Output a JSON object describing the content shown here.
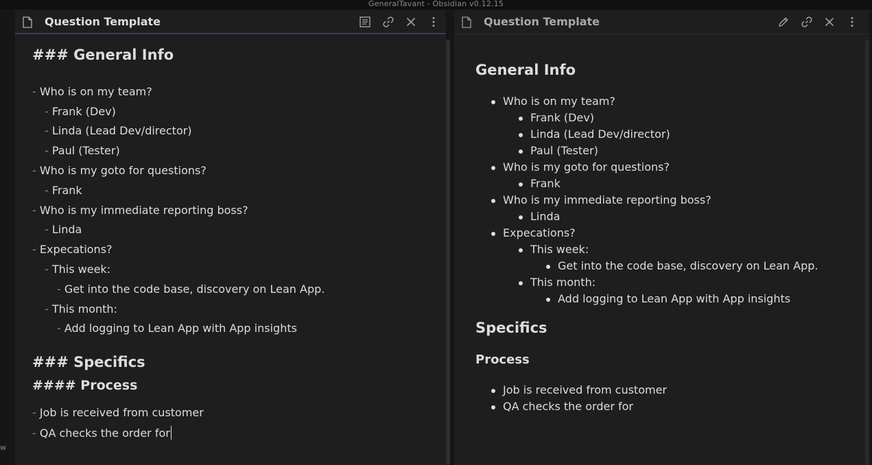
{
  "window": {
    "title": "GeneralTavant - Obsidian v0.12.15"
  },
  "left_strip": {
    "fragment": "w"
  },
  "left_pane": {
    "title": "Question Template",
    "icons": [
      "preview-icon",
      "link-icon",
      "close-icon",
      "more-options-icon"
    ],
    "lines": [
      {
        "text": "### General Info",
        "kind": "h3"
      },
      {
        "text": "- Who is on my team?",
        "kind": "li",
        "indent": 0
      },
      {
        "text": "- Frank (Dev)",
        "kind": "li",
        "indent": 1
      },
      {
        "text": "- Linda (Lead Dev/director)",
        "kind": "li",
        "indent": 1
      },
      {
        "text": "- Paul (Tester)",
        "kind": "li",
        "indent": 1
      },
      {
        "text": "- Who is my goto for questions?",
        "kind": "li",
        "indent": 0
      },
      {
        "text": "- Frank",
        "kind": "li",
        "indent": 1
      },
      {
        "text": "- Who is my immediate reporting boss?",
        "kind": "li",
        "indent": 0
      },
      {
        "text": "- Linda",
        "kind": "li",
        "indent": 1
      },
      {
        "text": "- Expecations?",
        "kind": "li",
        "indent": 0
      },
      {
        "text": "- This week:",
        "kind": "li",
        "indent": 1
      },
      {
        "text": "- Get into the code base, discovery on Lean App.",
        "kind": "li",
        "indent": 2
      },
      {
        "text": "- This month:",
        "kind": "li",
        "indent": 1
      },
      {
        "text": "- Add logging to Lean App with App insights",
        "kind": "li",
        "indent": 2
      },
      {
        "text": "### Specifics",
        "kind": "h3"
      },
      {
        "text": "#### Process",
        "kind": "h4"
      },
      {
        "text": "- Job is received from customer",
        "kind": "li",
        "indent": 0
      },
      {
        "text": "- QA checks the order for",
        "kind": "li",
        "indent": 0
      }
    ]
  },
  "right_pane": {
    "title": "Question Template",
    "icons": [
      "edit-icon",
      "link-icon",
      "close-icon",
      "more-options-icon"
    ],
    "blocks": [
      {
        "text": "General Info",
        "kind": "h2"
      },
      {
        "text": "Who is on my team?",
        "kind": "li",
        "indent": 0
      },
      {
        "text": "Frank (Dev)",
        "kind": "li",
        "indent": 1
      },
      {
        "text": "Linda (Lead Dev/director)",
        "kind": "li",
        "indent": 1
      },
      {
        "text": "Paul (Tester)",
        "kind": "li",
        "indent": 1
      },
      {
        "text": "Who is my goto for questions?",
        "kind": "li",
        "indent": 0
      },
      {
        "text": "Frank",
        "kind": "li",
        "indent": 1
      },
      {
        "text": "Who is my immediate reporting boss?",
        "kind": "li",
        "indent": 0
      },
      {
        "text": "Linda",
        "kind": "li",
        "indent": 1
      },
      {
        "text": "Expecations?",
        "kind": "li",
        "indent": 0
      },
      {
        "text": "This week:",
        "kind": "li",
        "indent": 1
      },
      {
        "text": "Get into the code base, discovery on Lean App.",
        "kind": "li",
        "indent": 2
      },
      {
        "text": "This month:",
        "kind": "li",
        "indent": 1
      },
      {
        "text": "Add logging to Lean App with App insights",
        "kind": "li",
        "indent": 2
      },
      {
        "text": "Specifics",
        "kind": "h2"
      },
      {
        "text": "Process",
        "kind": "h3"
      },
      {
        "text": "Job is received from customer",
        "kind": "li",
        "indent": 0
      },
      {
        "text": "QA checks the order for",
        "kind": "li",
        "indent": 0
      }
    ]
  },
  "colors": {
    "background": "#1e1e1e",
    "text": "#dcddde",
    "active_underline": "#3a3d55"
  }
}
